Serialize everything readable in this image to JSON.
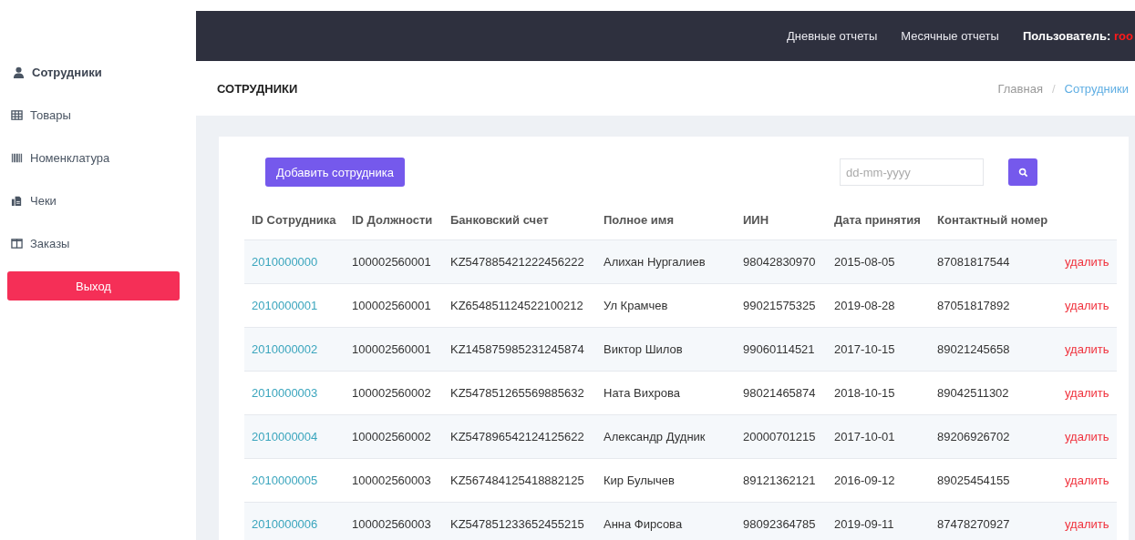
{
  "sidebar": {
    "items": [
      {
        "label": "Сотрудники",
        "kind": "user",
        "selected": true
      },
      {
        "label": "Товары",
        "kind": "grid",
        "selected": false
      },
      {
        "label": "Номенклатура",
        "kind": "barcode",
        "selected": false
      },
      {
        "label": "Чеки",
        "kind": "fax",
        "selected": false
      },
      {
        "label": "Заказы",
        "kind": "columns",
        "selected": false
      }
    ],
    "logout_button": "Выход"
  },
  "top_bar": {
    "links": [
      "Дневные отчеты",
      "Месячные отчеты"
    ],
    "user": {
      "label": "Пользователь:",
      "value": "roo"
    }
  },
  "page_header": {
    "title": "СОТРУДНИКИ",
    "breadcrumb": [
      {
        "label": "Главная",
        "current": false
      },
      {
        "label": "Сотрудники",
        "current": true
      }
    ],
    "separator": "/"
  },
  "toolbar": {
    "add_button": "Добавить сотрудника",
    "date_field": {
      "placeholder": "dd-mm-yyyy"
    }
  },
  "table": {
    "columns": [
      "ID Сотрудника",
      "ID Должности",
      "Банковский счет",
      "Полное имя",
      "ИИН",
      "Дата принятия",
      "Контактный номер"
    ],
    "rows": [
      {
        "cells": [
          "2010000000",
          "100002560001",
          "KZ547885421222456222",
          "Алихан Нургалиев",
          "98042830970",
          "2015-08-05",
          "87081817544"
        ],
        "action": "удалить"
      },
      {
        "cells": [
          "2010000001",
          "100002560001",
          "KZ654851124522100212",
          "Ул Крамчев",
          "99021575325",
          "2019-08-28",
          "87051817892"
        ],
        "action": "удалить"
      },
      {
        "cells": [
          "2010000002",
          "100002560001",
          "KZ145875985231245874",
          "Виктор Шилов",
          "99060114521",
          "2017-10-15",
          "89021245658"
        ],
        "action": "удалить"
      },
      {
        "cells": [
          "2010000003",
          "100002560002",
          "KZ547851265569885632",
          "Ната Вихрова",
          "98021465874",
          "2018-10-15",
          "89042511302"
        ],
        "action": "удалить"
      },
      {
        "cells": [
          "2010000004",
          "100002560002",
          "KZ547896542124125622",
          "Александр Дудник",
          "20000701215",
          "2017-10-01",
          "89206926702"
        ],
        "action": "удалить"
      },
      {
        "cells": [
          "2010000005",
          "100002560003",
          "KZ567484125418882125",
          "Кир Булычев",
          "89121362121",
          "2016-09-12",
          "89025454155"
        ],
        "action": "удалить"
      },
      {
        "cells": [
          "2010000006",
          "100002560003",
          "KZ547851233652455215",
          "Анна Фирсова",
          "98092364785",
          "2019-09-11",
          "87478270927"
        ],
        "action": "удалить"
      }
    ]
  }
}
